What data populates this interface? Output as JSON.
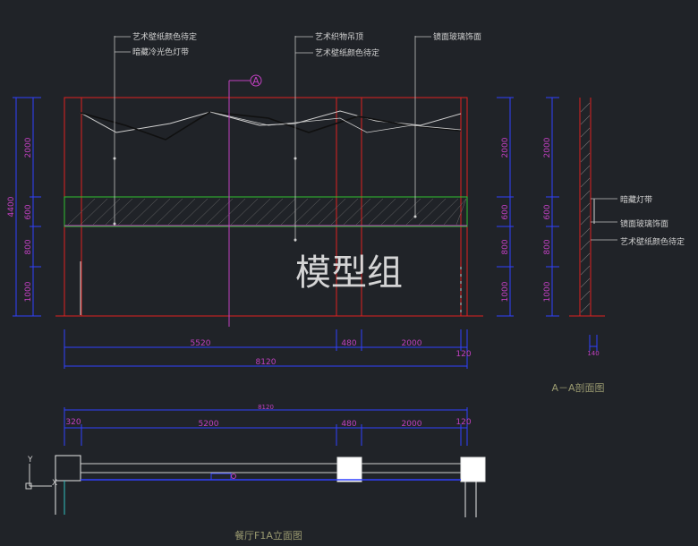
{
  "watermark": "模型组",
  "elevation": {
    "caption": "餐厅F1A立面图",
    "section_marker": "A",
    "callouts_top": [
      "艺术壁纸颜色待定",
      "暗藏冷光色灯带",
      "艺术织物吊顶",
      "艺术壁纸颜色待定",
      "镜面玻璃饰面"
    ],
    "left_dims": [
      "2000",
      "600",
      "800",
      "1000"
    ],
    "left_total": "4400",
    "right_dims": [
      "2000",
      "600",
      "800",
      "1000"
    ],
    "bottom_dims": [
      "5520",
      "480",
      "2000",
      "120"
    ],
    "bottom_total": "8120"
  },
  "section": {
    "caption": "A－A剖面图",
    "callouts": [
      "暗藏灯带",
      "镜面玻璃饰面",
      "艺术壁纸颜色待定"
    ],
    "dims": [
      "2000",
      "600",
      "800",
      "1000"
    ],
    "bottom_dim": "140"
  },
  "plan": {
    "top_total": "8120",
    "dims": [
      "320",
      "5200",
      "480",
      "2000",
      "120"
    ],
    "axis_y": "Y",
    "axis_x": "X"
  },
  "colors": {
    "background": "#202328",
    "red": "#e02020",
    "magenta": "#c040c0",
    "blue": "#3040ff",
    "green": "#30c030",
    "white": "#e8e8e8"
  }
}
